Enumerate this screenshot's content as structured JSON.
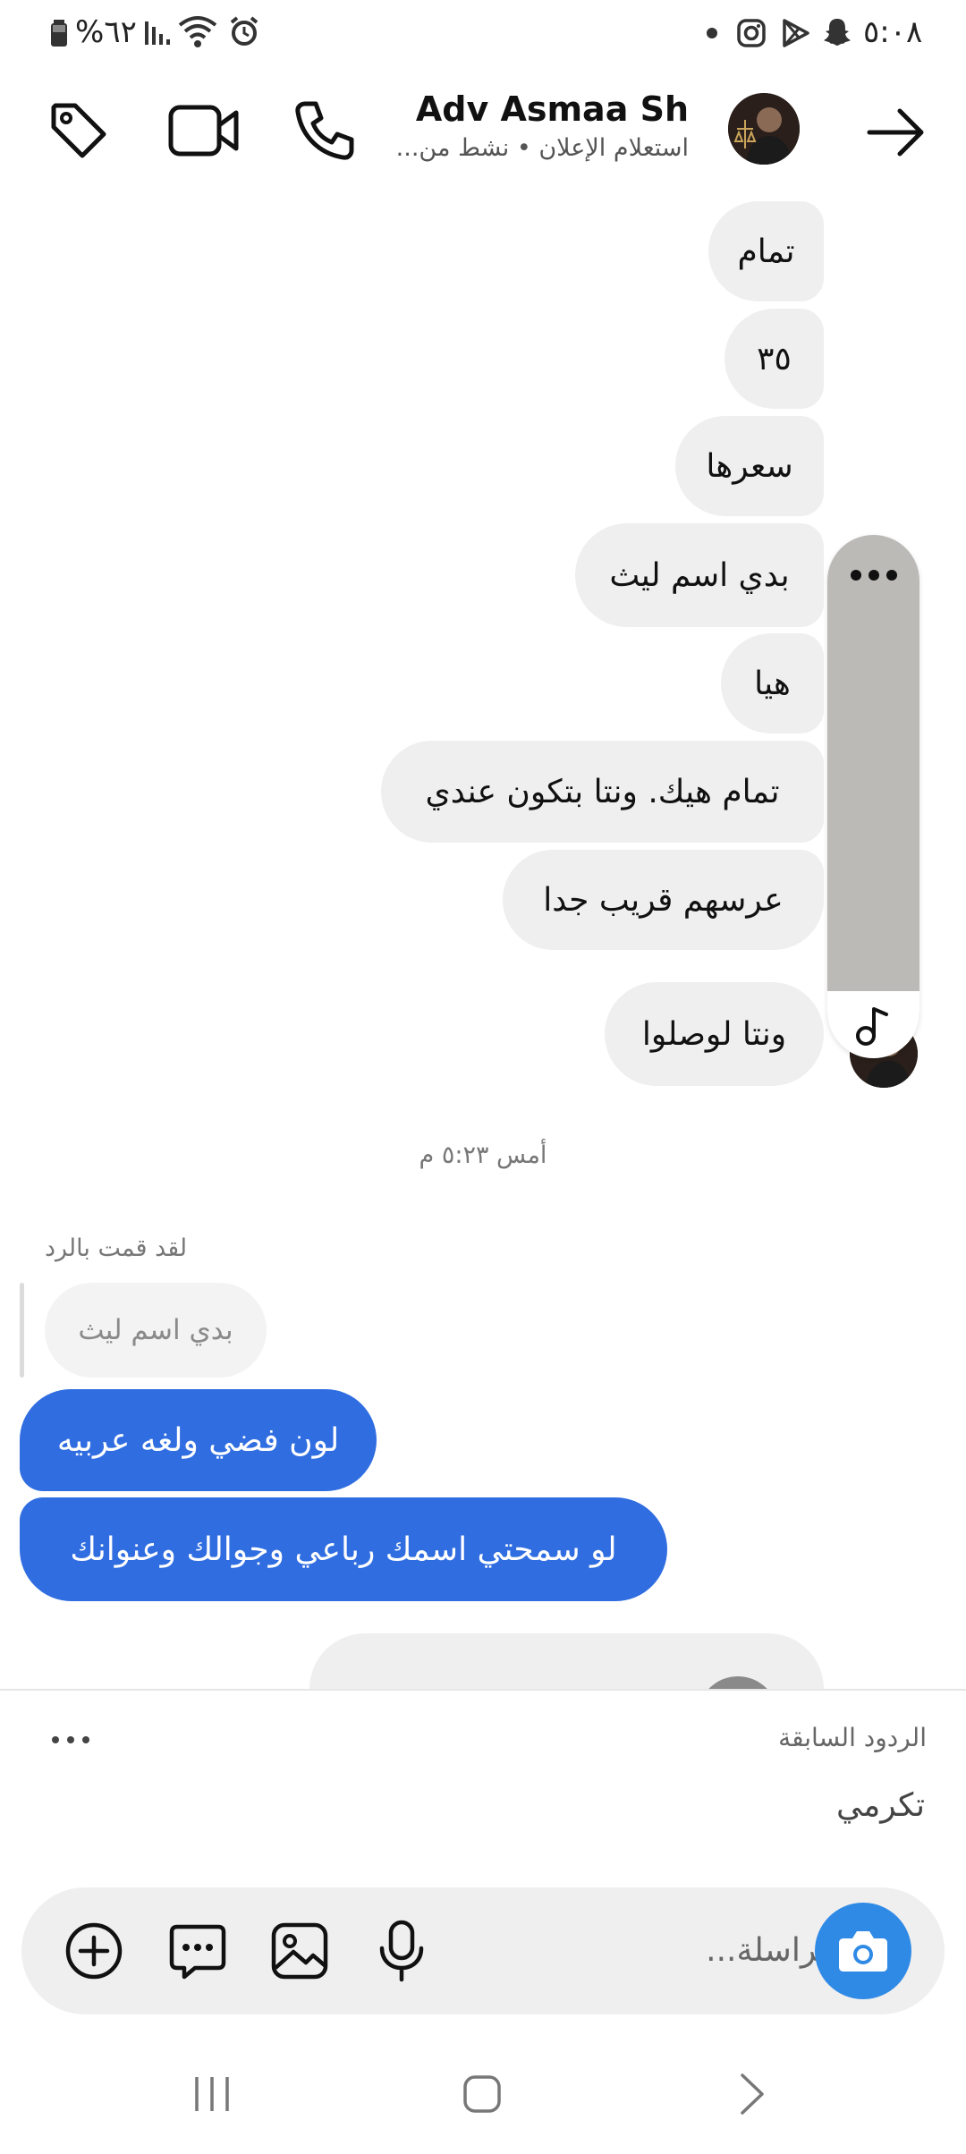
{
  "status_bar": {
    "time": "٥:٠٨",
    "battery": "%٦٢"
  },
  "header": {
    "name": "Adv Asmaa Sh",
    "subtitle": "استعلام الإعلان • نشط من..."
  },
  "messages": [
    {
      "text": "تمام"
    },
    {
      "text": "٣٥"
    },
    {
      "text": "سعرها"
    },
    {
      "text": "بدي اسم ليث"
    },
    {
      "text": "هيا"
    },
    {
      "text": "تمام هيك. ونتا بتكون عندي"
    },
    {
      "text": "عرسهم  قريب جدا"
    },
    {
      "text": "ونتا لوصلوا"
    }
  ],
  "timestamp": "أمس ٥:٢٣ م",
  "reply": {
    "label": "لقد قمت بالرد",
    "quoted": "بدي اسم ليث"
  },
  "sent": [
    {
      "text": "لون فضي ولغه عربيه"
    },
    {
      "text": "لو سمحتي اسمك رباعي وجوالك وعنوانك"
    }
  ],
  "quick_replies": {
    "title": "الردود السابقة",
    "items": [
      "تكرمي"
    ]
  },
  "composer": {
    "placeholder": "مراسلة..."
  },
  "icons": [
    "tag-icon",
    "video-icon",
    "phone-icon",
    "back-arrow-icon",
    "camera-icon",
    "mic-icon",
    "image-icon",
    "sticker-icon",
    "plus-icon",
    "music-note-icon",
    "more-icon"
  ],
  "colors": {
    "sent_bubble": "#2f6de1",
    "received_bubble": "#efefef",
    "camera_button": "#2f8ae6"
  }
}
